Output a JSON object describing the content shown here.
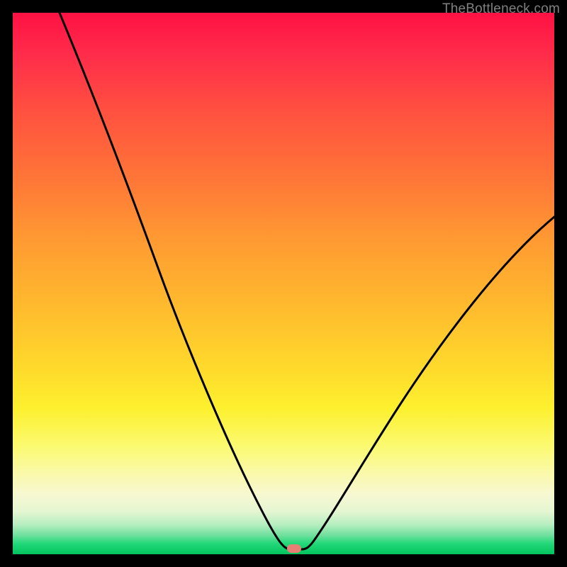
{
  "watermark": "TheBottleneck.com",
  "marker": {
    "x_frac": 0.52,
    "y_frac": 0.99
  },
  "chart_data": {
    "type": "line",
    "title": "",
    "xlabel": "",
    "ylabel": "",
    "xlim": [
      0,
      1
    ],
    "ylim": [
      0,
      1
    ],
    "legend": false,
    "grid": false,
    "background": "rainbow-gradient red→green",
    "series": [
      {
        "name": "bottleneck-curve",
        "x": [
          0.0,
          0.07,
          0.14,
          0.21,
          0.28,
          0.35,
          0.4,
          0.44,
          0.47,
          0.49,
          0.5,
          0.515,
          0.54,
          0.58,
          0.64,
          0.72,
          0.8,
          0.88,
          0.96,
          1.0
        ],
        "y": [
          1.0,
          0.86,
          0.72,
          0.58,
          0.42,
          0.26,
          0.16,
          0.08,
          0.04,
          0.02,
          0.015,
          0.015,
          0.02,
          0.06,
          0.14,
          0.26,
          0.38,
          0.49,
          0.58,
          0.62
        ]
      }
    ],
    "annotations": [
      {
        "type": "marker",
        "shape": "pill",
        "color": "#e77f74",
        "x": 0.52,
        "y": 0.01
      }
    ]
  }
}
